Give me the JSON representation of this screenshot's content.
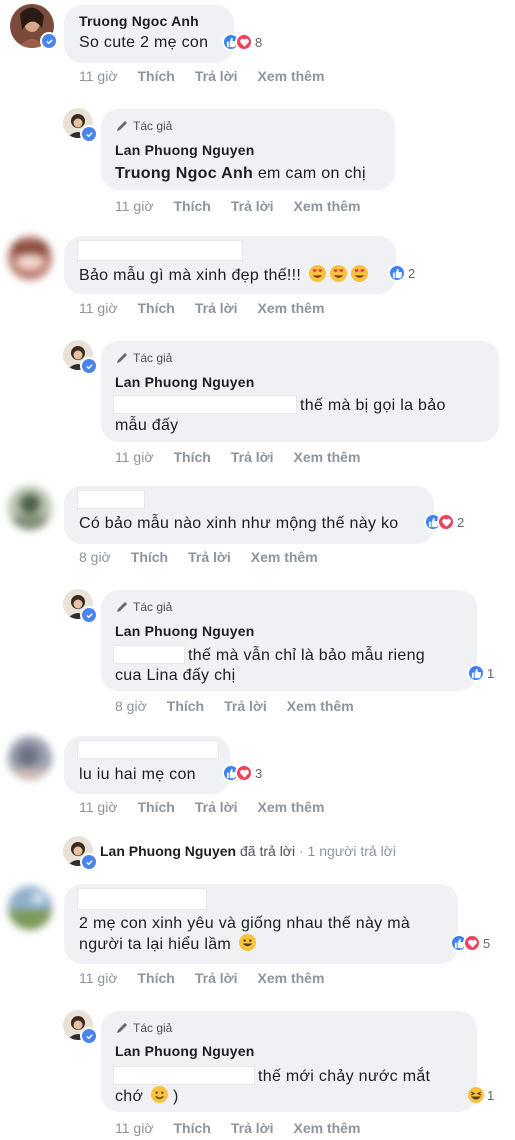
{
  "actions": {
    "like": "Thích",
    "reply": "Trả lời",
    "more": "Xem thêm"
  },
  "author_label": "Tác giả",
  "author_name": "Lan Phuong Nguyen",
  "comments": [
    {
      "name": "Truong Ngoc Anh",
      "text": "So cute 2 mẹ con",
      "reactions": "8",
      "time": "11 giờ"
    },
    {
      "reply_mention": "Truong Ngoc Anh",
      "text": "em cam on chị",
      "time": "11 giờ"
    },
    {
      "text": "Bảo mẫu gì mà xinh đẹp thế!!!",
      "reactions": "2",
      "time": "11 giờ"
    },
    {
      "text_line1": "thế mà bị gọi la bảo",
      "text_line2": "mẫu đấy",
      "time": "11 giờ"
    },
    {
      "text": "Có bảo mẫu nào xinh như mộng thế này ko",
      "reactions": "2",
      "time": "8 giờ"
    },
    {
      "text_line1": "thế mà vẫn chỉ là bảo mẫu rieng",
      "text_line2": "cua Lina đấy chị",
      "reactions": "1",
      "time": "8 giờ"
    },
    {
      "text": "lu iu hai mẹ con",
      "reactions": "3",
      "time": "11 giờ"
    },
    {
      "text_line1": "2 mẹ con xinh yêu và giống nhau thế này mà",
      "text_line2": "người ta lại hiểu lầm",
      "reactions": "5",
      "time": "11 giờ"
    },
    {
      "text_line1": "thế mới chảy nước mắt",
      "text_line2": "chớ",
      "text_line2_end": ")",
      "reactions": "1",
      "time": "11 giờ"
    }
  ],
  "reply_summary": {
    "name": "Lan Phuong Nguyen",
    "action": "đã trả lời",
    "sep": "·",
    "count": "1 người trả lời"
  }
}
